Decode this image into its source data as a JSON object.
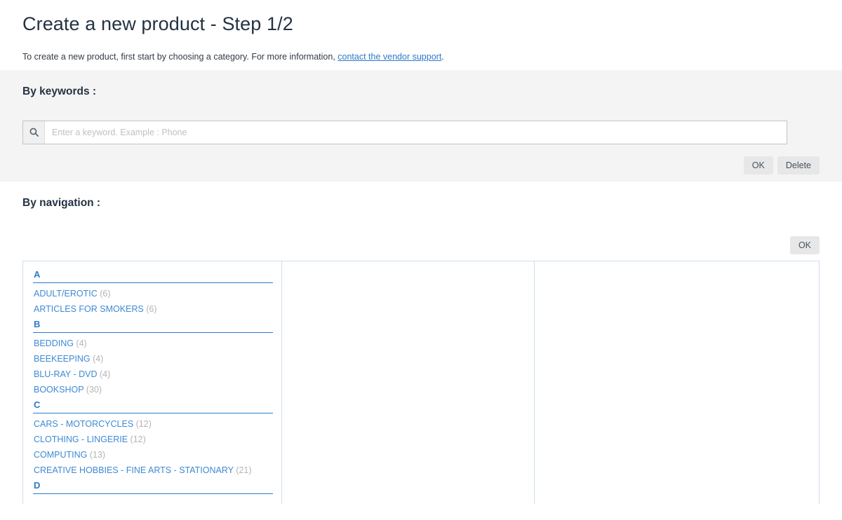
{
  "header": {
    "title": "Create a new product - Step 1/2",
    "intro_before": "To create a new product, first start by choosing a category. For more information, ",
    "intro_link": "contact the vendor support",
    "intro_after": "."
  },
  "keywords": {
    "heading": "By keywords :",
    "search_icon": "search-icon",
    "placeholder": "Enter a keyword. Example : Phone",
    "value": "",
    "ok_label": "OK",
    "delete_label": "Delete"
  },
  "navigation": {
    "heading": "By navigation :",
    "ok_label": "OK",
    "columns": [
      {
        "groups": [
          {
            "letter": "A",
            "items": [
              {
                "label": "ADULT/EROTIC",
                "count": "(6)"
              },
              {
                "label": "ARTICLES FOR SMOKERS",
                "count": "(6)"
              }
            ]
          },
          {
            "letter": "B",
            "items": [
              {
                "label": "BEDDING",
                "count": "(4)"
              },
              {
                "label": "BEEKEEPING",
                "count": "(4)"
              },
              {
                "label": "BLU-RAY - DVD",
                "count": "(4)"
              },
              {
                "label": "BOOKSHOP",
                "count": "(30)"
              }
            ]
          },
          {
            "letter": "C",
            "items": [
              {
                "label": "CARS - MOTORCYCLES",
                "count": "(12)"
              },
              {
                "label": "CLOTHING - LINGERIE",
                "count": "(12)"
              },
              {
                "label": "COMPUTING",
                "count": "(13)"
              },
              {
                "label": "CREATIVE HOBBIES - FINE ARTS - STATIONARY",
                "count": "(21)"
              }
            ]
          },
          {
            "letter": "D",
            "items": []
          }
        ]
      },
      {
        "groups": []
      },
      {
        "groups": []
      }
    ]
  },
  "colors": {
    "link": "#2c7ac9",
    "category_text": "#3d8ad4",
    "count_text": "#b4b4b4",
    "panel_bg": "#f4f4f4",
    "border": "#cfdfed"
  }
}
